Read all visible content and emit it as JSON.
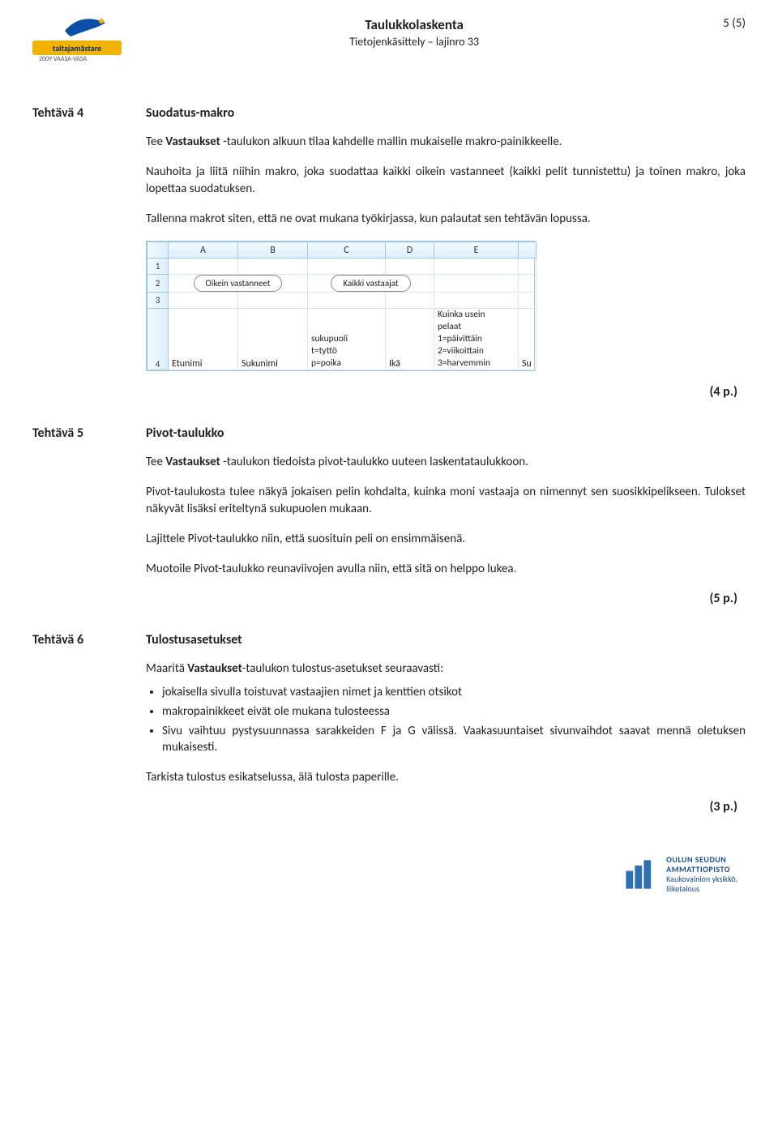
{
  "header": {
    "logo_text": "taitajamästare",
    "logo_year": "2009 VAASA-VASA",
    "title": "Taulukkolaskenta",
    "subtitle": "Tietojenkäsittely – lajinro 33",
    "page_counter": "5 (5)"
  },
  "t4": {
    "label": "Tehtävä 4",
    "heading": "Suodatus-makro",
    "p1a": "Tee ",
    "p1b_bold": "Vastaukset",
    "p1c": " -taulukon alkuun tilaa kahdelle mallin mukaiselle makro-painikkeelle.",
    "p2": "Nauhoita ja liitä niihin makro, joka suodattaa kaikki oikein vastanneet (kaikki pelit tunnistettu) ja toinen makro, joka lopettaa suodatuksen.",
    "p3": "Tallenna makrot siten, että ne ovat mukana työkirjassa, kun palautat sen tehtävän lopussa.",
    "score": "(4 p.)"
  },
  "excel": {
    "cols": [
      "A",
      "B",
      "C",
      "D",
      "E"
    ],
    "rows": [
      "1",
      "2",
      "3",
      "4"
    ],
    "btn1": "Oikein vastanneet",
    "btn2": "Kaikki vastaajat",
    "r4a": "Etunimi",
    "r4b": "Sukunimi",
    "c_col": "sukupuoli\nt=tyttö\np=poika",
    "d_col": "Ikä",
    "e_col": "Kuinka usein\npelaat\n1=päivittäin\n2=viikoittain\n3=harvemmin",
    "f_partial": "Su"
  },
  "t5": {
    "label": "Tehtävä 5",
    "heading": "Pivot-taulukko",
    "p1a": "Tee ",
    "p1b_bold": "Vastaukset",
    "p1c": " -taulukon tiedoista pivot-taulukko uuteen laskentataulukkoon.",
    "p2": "Pivot-taulukosta tulee näkyä jokaisen pelin kohdalta, kuinka moni vastaaja on nimennyt sen suosikkipelikseen. Tulokset näkyvät lisäksi eriteltynä sukupuolen mukaan.",
    "p3": "Lajittele Pivot-taulukko niin, että suosituin peli on ensimmäisenä.",
    "p4": "Muotoile Pivot-taulukko reunaviivojen avulla niin, että sitä on helppo lukea.",
    "score": "(5 p.)"
  },
  "t6": {
    "label": "Tehtävä 6",
    "heading": "Tulostusasetukset",
    "p1a": "Maaritä  ",
    "p1b_bold": "Vastaukset",
    "p1c": "-taulukon tulostus-asetukset seuraavasti:",
    "bullets": [
      "jokaisella sivulla toistuvat vastaajien nimet ja kenttien otsikot",
      "makropainikkeet eivät ole mukana tulosteessa",
      "Sivu vaihtuu pystysuunnassa sarakkeiden F ja G välissä. Vaakasuuntaiset sivunvaihdot saavat mennä oletuksen mukaisesti."
    ],
    "p_last": "Tarkista tulostus esikatselussa, älä tulosta paperille.",
    "score": "(3 p.)"
  },
  "footer": {
    "line1": "OULUN SEUDUN",
    "line2": "AMMATTIOPISTO",
    "line3": "Kaukovainion yksikkö,",
    "line4": "liiketalous"
  }
}
